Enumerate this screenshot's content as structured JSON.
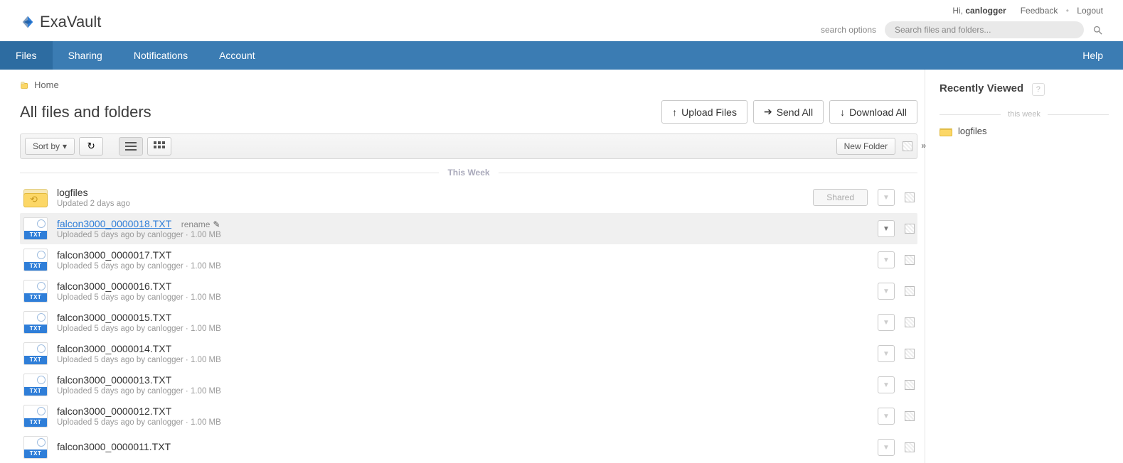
{
  "brand": "ExaVault",
  "header": {
    "greeting": "Hi,",
    "username": "canlogger",
    "feedback": "Feedback",
    "logout": "Logout",
    "search_options": "search options",
    "search_placeholder": "Search files and folders..."
  },
  "nav": {
    "items": [
      "Files",
      "Sharing",
      "Notifications",
      "Account"
    ],
    "help": "Help"
  },
  "breadcrumb": {
    "home": "Home"
  },
  "page_title": "All files and folders",
  "actions": {
    "upload": "Upload Files",
    "send": "Send All",
    "download": "Download All"
  },
  "toolbar": {
    "sort": "Sort by",
    "new_folder": "New Folder"
  },
  "section_label": "This Week",
  "folder": {
    "name": "logfiles",
    "meta": "Updated 2 days ago",
    "shared": "Shared"
  },
  "rename_label": "rename",
  "files": [
    {
      "name": "falcon3000_0000018.TXT",
      "meta": "Uploaded 5 days ago by canlogger · 1.00 MB",
      "active": true
    },
    {
      "name": "falcon3000_0000017.TXT",
      "meta": "Uploaded 5 days ago by canlogger · 1.00 MB",
      "active": false
    },
    {
      "name": "falcon3000_0000016.TXT",
      "meta": "Uploaded 5 days ago by canlogger · 1.00 MB",
      "active": false
    },
    {
      "name": "falcon3000_0000015.TXT",
      "meta": "Uploaded 5 days ago by canlogger · 1.00 MB",
      "active": false
    },
    {
      "name": "falcon3000_0000014.TXT",
      "meta": "Uploaded 5 days ago by canlogger · 1.00 MB",
      "active": false
    },
    {
      "name": "falcon3000_0000013.TXT",
      "meta": "Uploaded 5 days ago by canlogger · 1.00 MB",
      "active": false
    },
    {
      "name": "falcon3000_0000012.TXT",
      "meta": "Uploaded 5 days ago by canlogger · 1.00 MB",
      "active": false
    },
    {
      "name": "falcon3000_0000011.TXT",
      "meta": "",
      "active": false
    }
  ],
  "side": {
    "title": "Recently Viewed",
    "week": "this week",
    "item": "logfiles"
  }
}
